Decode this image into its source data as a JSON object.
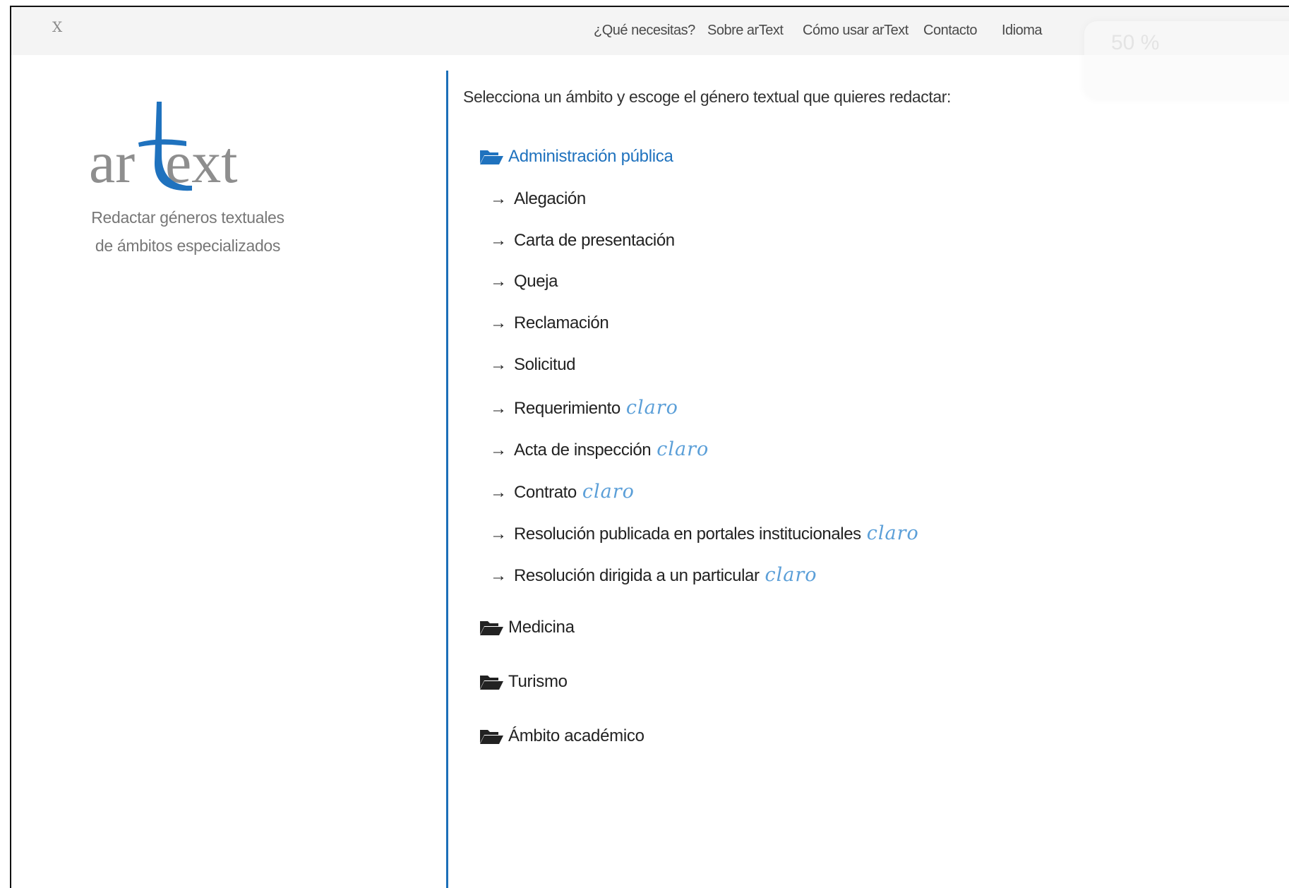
{
  "topbar": {
    "close_label": "X",
    "nav": [
      {
        "label": "¿Qué necesitas?"
      },
      {
        "label": "Sobre arText"
      },
      {
        "label": "Cómo usar arText"
      },
      {
        "label": "Contacto"
      },
      {
        "label": "Idioma"
      }
    ],
    "zoom_label": "50 %"
  },
  "sidebar": {
    "logo_text": "artext",
    "tagline_line1": "Redactar géneros textuales",
    "tagline_line2": "de ámbitos especializados"
  },
  "main": {
    "intro": "Selecciona un ámbito y escoge el género textual que quieres redactar:",
    "categories": [
      {
        "label": "Administración pública",
        "expanded": true,
        "genres": [
          {
            "label": "Alegación",
            "tag": ""
          },
          {
            "label": "Carta de presentación",
            "tag": ""
          },
          {
            "label": "Queja",
            "tag": ""
          },
          {
            "label": "Reclamación",
            "tag": ""
          },
          {
            "label": "Solicitud",
            "tag": ""
          },
          {
            "label": "Requerimiento",
            "tag": "claro"
          },
          {
            "label": "Acta de inspección",
            "tag": "claro"
          },
          {
            "label": "Contrato",
            "tag": "claro"
          },
          {
            "label": "Resolución publicada en portales institucionales",
            "tag": "claro"
          },
          {
            "label": "Resolución dirigida a un particular",
            "tag": "claro"
          }
        ]
      },
      {
        "label": "Medicina",
        "expanded": false,
        "genres": []
      },
      {
        "label": "Turismo",
        "expanded": false,
        "genres": []
      },
      {
        "label": "Ámbito académico",
        "expanded": false,
        "genres": []
      }
    ]
  },
  "colors": {
    "accent": "#1f72be",
    "claro": "#5b9fd8",
    "topbar_bg": "#f4f4f4",
    "rule": "#1c6fb8"
  },
  "icons": {
    "category": "folder-open-icon",
    "genre": "arrow-right-icon"
  }
}
